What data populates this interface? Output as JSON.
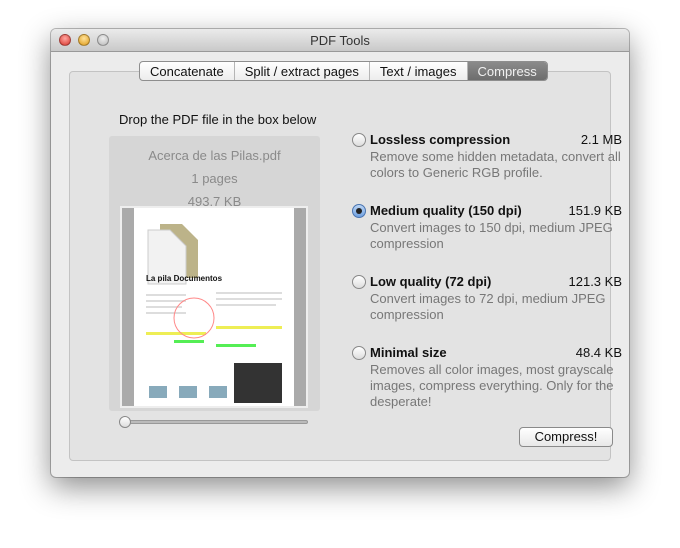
{
  "window": {
    "title": "PDF Tools"
  },
  "tabs": [
    {
      "label": "Concatenate"
    },
    {
      "label": "Split / extract pages"
    },
    {
      "label": "Text / images"
    },
    {
      "label": "Compress",
      "selected": true
    }
  ],
  "drop": {
    "label": "Drop the PDF file in the box below",
    "filename": "Acerca de las Pilas.pdf",
    "pages": "1 pages",
    "size": "493.7 KB",
    "preview_heading": "La pila Documentos"
  },
  "options": [
    {
      "title": "Lossless compression",
      "size": "2.1 MB",
      "desc": "Remove some hidden metadata, convert all colors to Generic RGB profile.",
      "selected": false
    },
    {
      "title": "Medium quality (150 dpi)",
      "size": "151.9 KB",
      "desc": "Convert images to 150 dpi, medium JPEG compression",
      "selected": true
    },
    {
      "title": "Low quality (72 dpi)",
      "size": "121.3 KB",
      "desc": "Convert images to 72 dpi, medium JPEG compression",
      "selected": false
    },
    {
      "title": "Minimal size",
      "size": "48.4 KB",
      "desc": "Removes all color images, most grayscale images, compress everything. Only for the desperate!",
      "selected": false
    }
  ],
  "compress_button": "Compress!"
}
